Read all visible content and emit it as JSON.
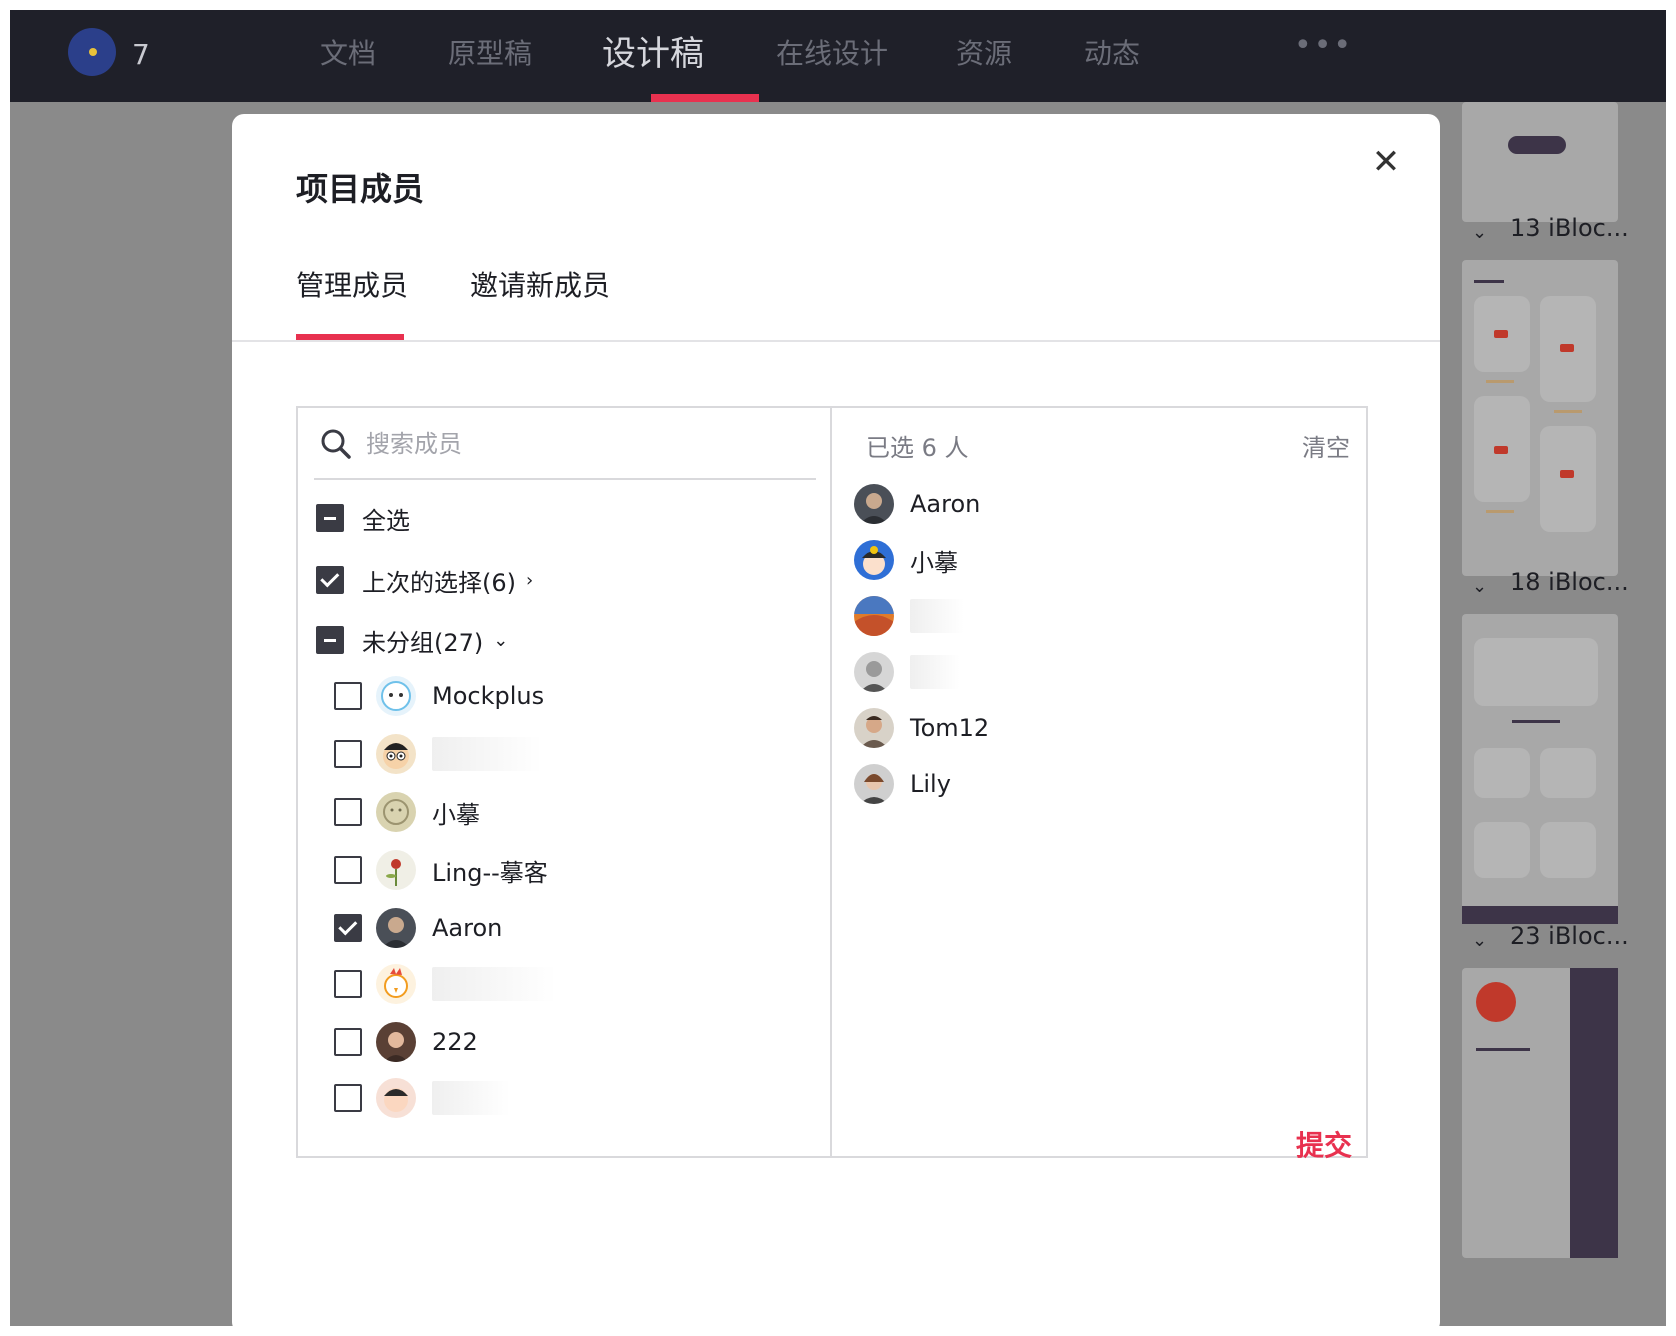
{
  "topbar": {
    "badge_count": "7",
    "nav": [
      "文档",
      "原型稿",
      "设计稿",
      "在线设计",
      "资源",
      "动态"
    ],
    "active_nav": "设计稿",
    "more": "•••"
  },
  "side_panels": [
    {
      "label": "13 iBloc..."
    },
    {
      "label": "18 iBloc..."
    },
    {
      "label": "23 iBloc..."
    }
  ],
  "modal": {
    "title": "项目成员",
    "tabs": [
      "管理成员",
      "邀请新成员"
    ],
    "active_tab": "管理成员",
    "search_placeholder": "搜索成员",
    "select_all": "全选",
    "last_selection": "上次的选择(6)",
    "ungrouped": "未分组(27)",
    "members": [
      {
        "name": "Mockplus",
        "checked": false,
        "avatar": "sheep-avatar"
      },
      {
        "name": "",
        "checked": false,
        "avatar": "cartoon-face-avatar"
      },
      {
        "name": "小摹",
        "checked": false,
        "avatar": "sketch-avatar"
      },
      {
        "name": "Ling--摹客",
        "checked": false,
        "avatar": "flower-avatar"
      },
      {
        "name": "Aaron",
        "checked": true,
        "avatar": "photo-avatar"
      },
      {
        "name": "",
        "checked": false,
        "avatar": "rooster-avatar"
      },
      {
        "name": "222",
        "checked": false,
        "avatar": "photo-avatar"
      },
      {
        "name": "",
        "checked": false,
        "avatar": "cartoon-girl-avatar"
      }
    ],
    "selected_count_label": "已选 6 人",
    "clear_label": "清空",
    "selected": [
      {
        "name": "Aaron"
      },
      {
        "name": "小摹"
      },
      {
        "name": ""
      },
      {
        "name": ""
      },
      {
        "name": "Tom12"
      },
      {
        "name": "Lily"
      }
    ],
    "submit_label": "提交"
  },
  "colors": {
    "accent": "#e8314f",
    "topbar": "#1f2029",
    "overlay": "#8a8a8a",
    "checkbox": "#3a3b44"
  }
}
